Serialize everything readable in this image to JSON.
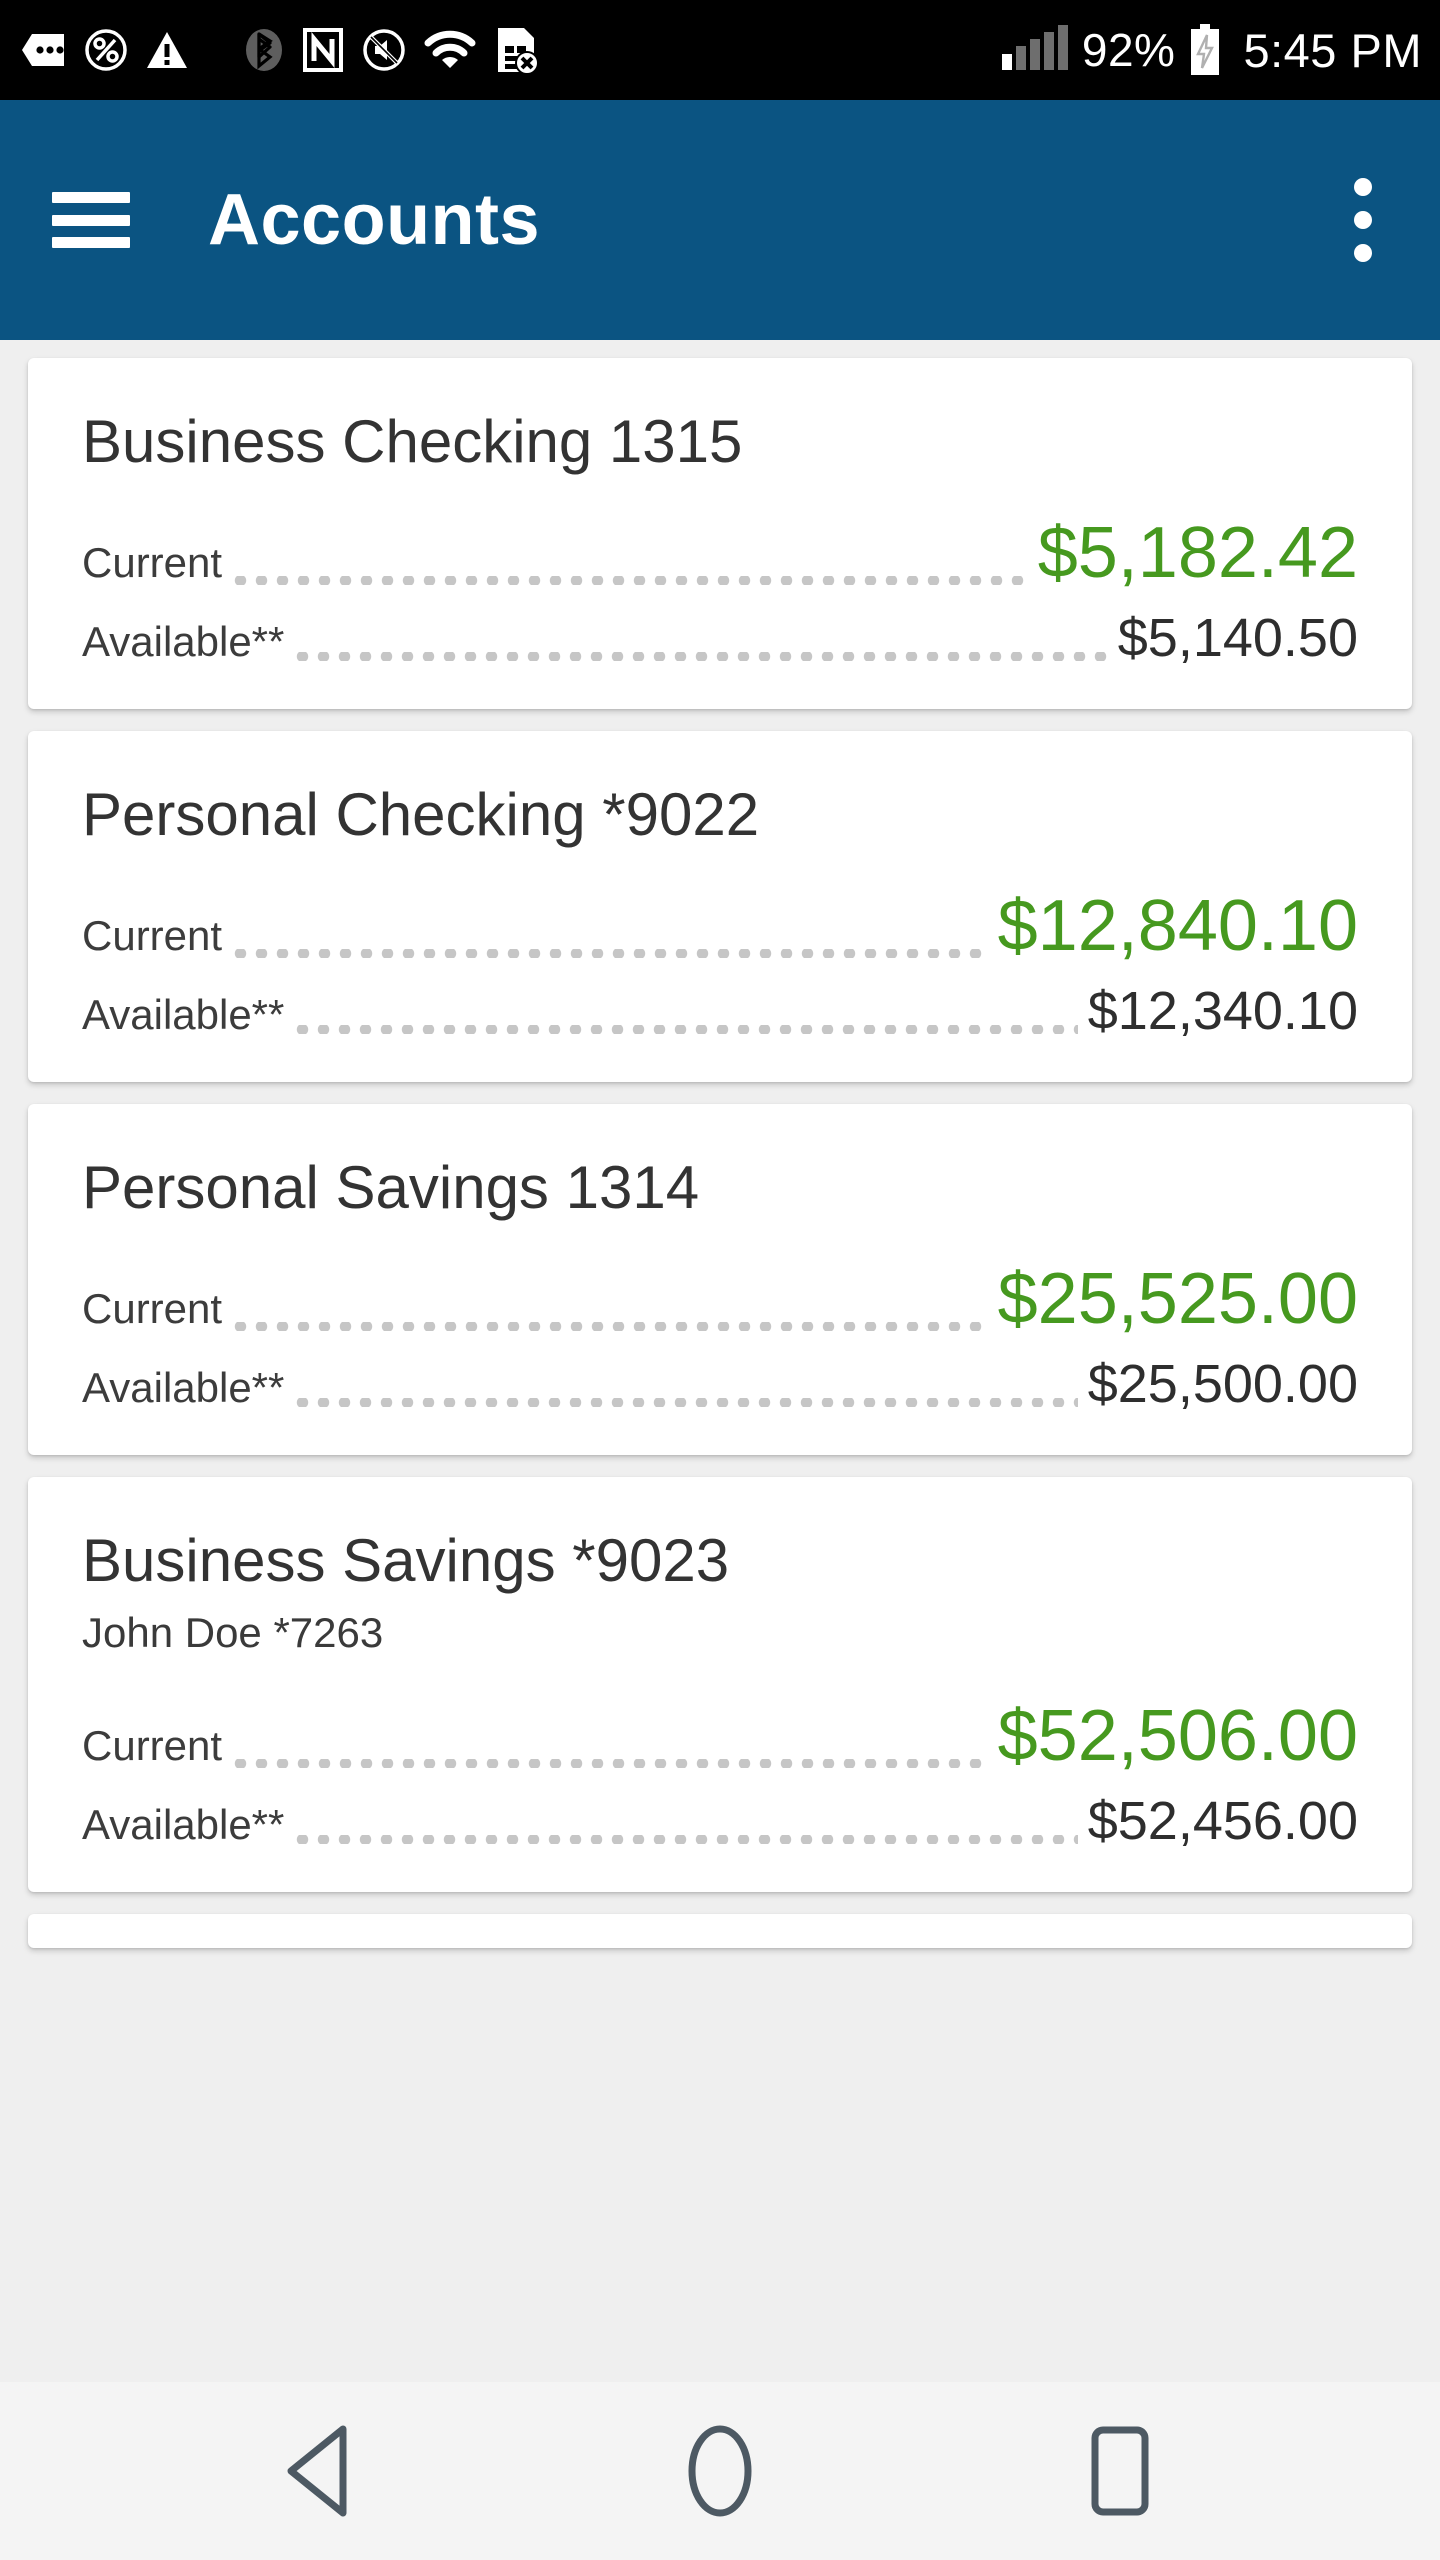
{
  "status_bar": {
    "icons": [
      "speech-bubble-icon",
      "percent-circle-icon",
      "warning-triangle-icon",
      "bluetooth-icon",
      "nfc-icon",
      "mute-icon",
      "wifi-icon",
      "sim-error-icon",
      "signal-bars-icon"
    ],
    "battery_percent": "92%",
    "battery_state": "charging",
    "time": "5:45 PM"
  },
  "app_bar": {
    "menu_icon": "hamburger-menu-icon",
    "title": "Accounts",
    "overflow_icon": "more-vertical-icon",
    "background": "#0B5482"
  },
  "colors": {
    "accent_blue": "#0B5482",
    "current_green": "#46991F",
    "available_dark": "#2E2E2E",
    "page_background": "#EFEFEF",
    "card_background": "#FFFFFF"
  },
  "labels": {
    "current": "Current",
    "available": "Available**"
  },
  "accounts": [
    {
      "title": "Business Checking 1315",
      "subtitle": "",
      "current": "$5,182.42",
      "available": "$5,140.50"
    },
    {
      "title": "Personal Checking *9022",
      "subtitle": "",
      "current": "$12,840.10",
      "available": "$12,340.10"
    },
    {
      "title": "Personal Savings 1314",
      "subtitle": "",
      "current": "$25,525.00",
      "available": "$25,500.00"
    },
    {
      "title": "Business Savings *9023",
      "subtitle": "John Doe *7263",
      "current": "$52,506.00",
      "available": "$52,456.00"
    }
  ],
  "nav_bar": {
    "back": "back-triangle-icon",
    "home": "home-circle-icon",
    "recents": "recents-square-icon"
  }
}
